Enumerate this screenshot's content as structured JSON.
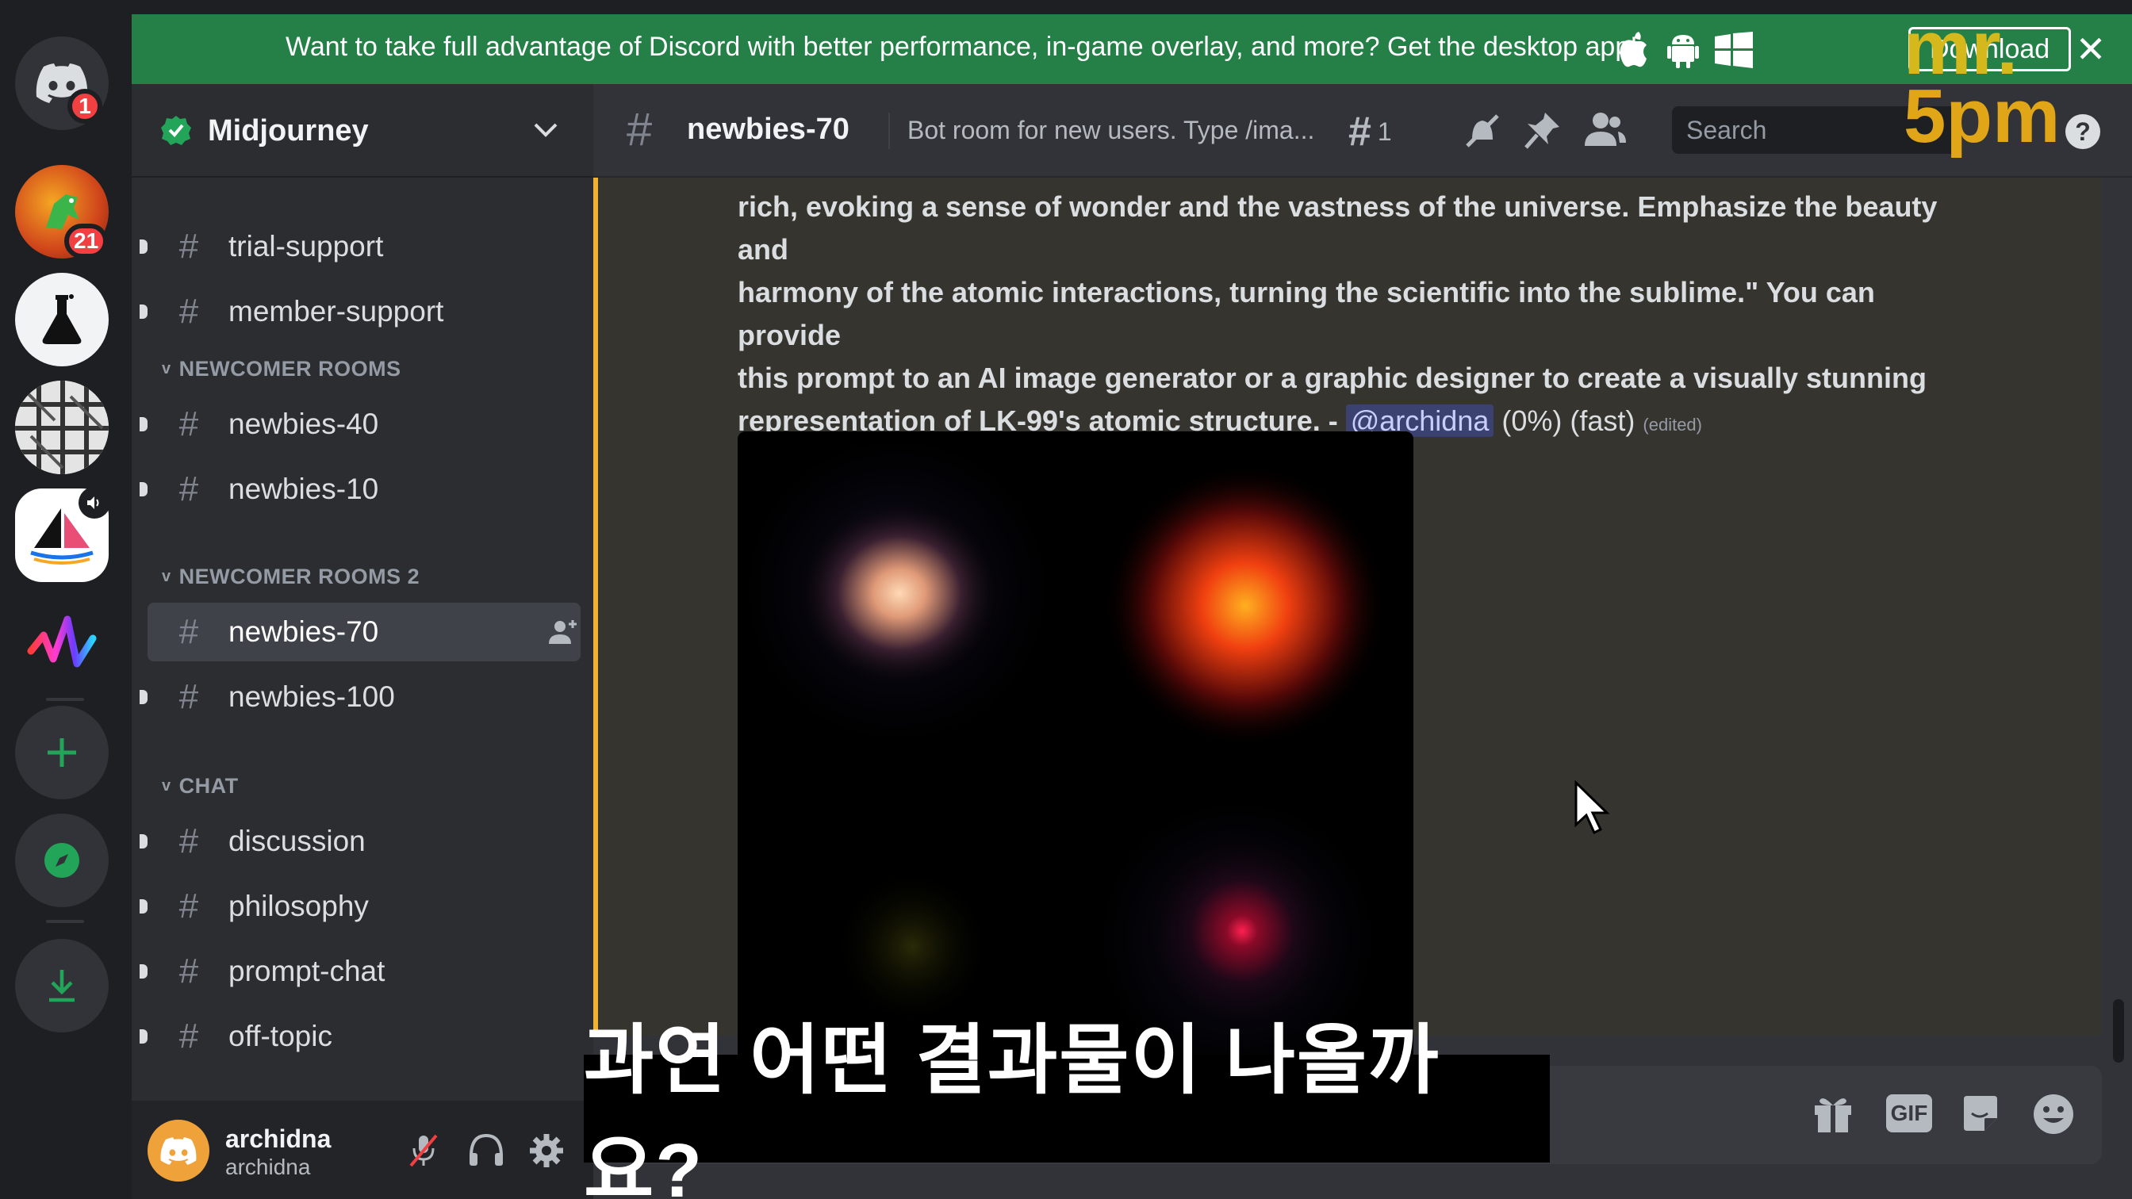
{
  "banner": {
    "message": "Want to take full advantage of Discord with better performance, in-game overlay, and more? Get the desktop app!",
    "download_label": "Download",
    "close_label": "✕"
  },
  "servers": {
    "home_badge": "1",
    "server2_badge": "21"
  },
  "guild": {
    "name": "Midjourney"
  },
  "categories": [
    {
      "label": "NEWCOMER ROOMS"
    },
    {
      "label": "NEWCOMER ROOMS 2"
    },
    {
      "label": "CHAT"
    }
  ],
  "channels": {
    "trial_support": "trial-support",
    "member_support": "member-support",
    "newbies_40": "newbies-40",
    "newbies_10": "newbies-10",
    "newbies_70": "newbies-70",
    "newbies_100": "newbies-100",
    "discussion": "discussion",
    "philosophy": "philosophy",
    "prompt_chat": "prompt-chat",
    "off_topic": "off-topic"
  },
  "user": {
    "name": "archidna",
    "tag": "archidna"
  },
  "topbar": {
    "channel": "newbies-70",
    "topic": "Bot room for new users. Type /ima...",
    "threads_count": "1",
    "search_placeholder": "Search"
  },
  "message": {
    "line1": "rich, evoking a sense of wonder and the vastness of the universe. Emphasize the beauty and",
    "line2": "harmony of the atomic interactions, turning the scientific into the sublime.\" You can provide",
    "line3": "this prompt to an AI image generator or a graphic designer to create a visually stunning",
    "line4": "representation of LK-99's atomic structure. - ",
    "mention": "@archidna",
    "status": " (0%) (fast) ",
    "edited": "(edited)"
  },
  "composer": {
    "gif_label": "GIF"
  },
  "overlay": {
    "subtitle": "과연 어떤 결과물이 나올까요?",
    "watermark_top": "mr.",
    "watermark_bottom": "5pm"
  },
  "colors": {
    "banner": "#248046",
    "accent": "#f0b232",
    "mention_bg": "#3c4270"
  }
}
